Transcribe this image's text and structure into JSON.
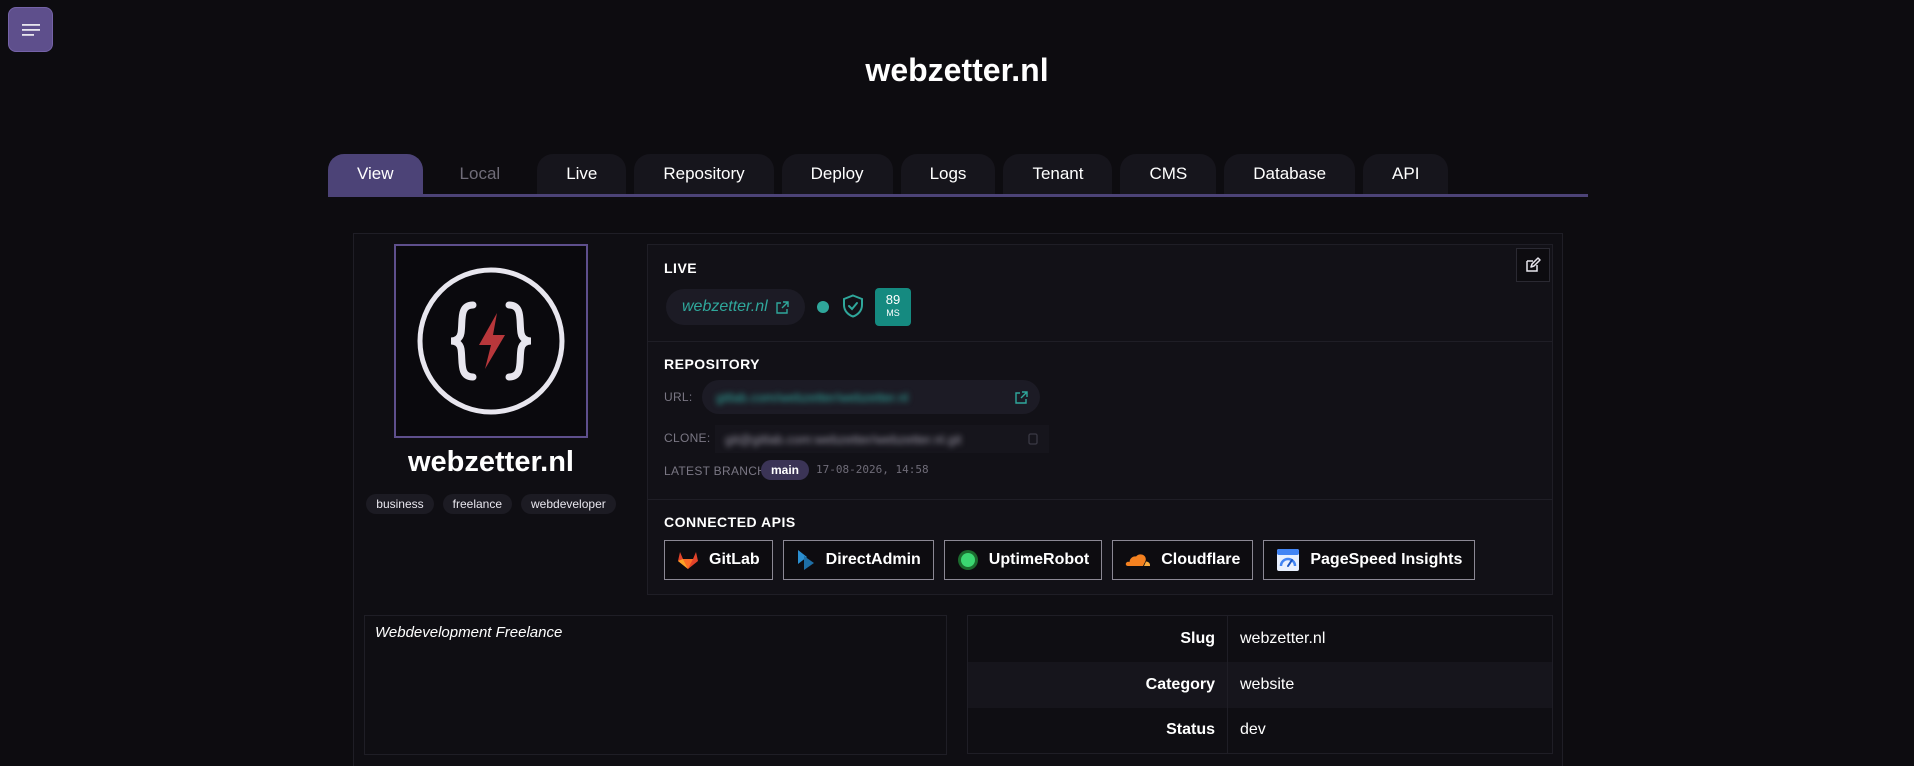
{
  "page": {
    "title": "webzetter.nl"
  },
  "menu": {
    "icon": "hamburger-icon",
    "accent": "#5e4f8c"
  },
  "tabs": [
    {
      "label": "View",
      "state": "active"
    },
    {
      "label": "Local",
      "state": "disabled"
    },
    {
      "label": "Live",
      "state": "normal"
    },
    {
      "label": "Repository",
      "state": "normal"
    },
    {
      "label": "Deploy",
      "state": "normal"
    },
    {
      "label": "Logs",
      "state": "normal"
    },
    {
      "label": "Tenant",
      "state": "normal"
    },
    {
      "label": "CMS",
      "state": "normal"
    },
    {
      "label": "Database",
      "state": "normal"
    },
    {
      "label": "API",
      "state": "normal"
    }
  ],
  "project": {
    "name": "webzetter.nl",
    "logo_icon": "curly-braces-lightning-logo",
    "tags": [
      "business",
      "freelance",
      "webdeveloper"
    ]
  },
  "live": {
    "label": "LIVE",
    "link_text": "webzetter.nl",
    "status_color": "#2fa79b",
    "response_value": "89",
    "response_unit": "MS"
  },
  "repository": {
    "label": "REPOSITORY",
    "url_label": "URL:",
    "url_value": "gitlab.com/webzetter/webzetter.nl",
    "clone_label": "CLONE:",
    "clone_value": "git@gitlab.com:webzetter/webzetter.nl.git",
    "branch_label": "LATEST BRANCH:",
    "branch": "main",
    "branch_date": "17-08-2026, 14:58"
  },
  "connected_apis": {
    "label": "CONNECTED APIS",
    "items": [
      {
        "label": "GitLab",
        "icon": "gitlab-icon"
      },
      {
        "label": "DirectAdmin",
        "icon": "directadmin-icon"
      },
      {
        "label": "UptimeRobot",
        "icon": "uptimerobot-icon"
      },
      {
        "label": "Cloudflare",
        "icon": "cloudflare-icon"
      },
      {
        "label": "PageSpeed Insights",
        "icon": "pagespeed-icon"
      }
    ]
  },
  "description": "Webdevelopment Freelance",
  "meta": [
    {
      "key": "Slug",
      "value": "webzetter.nl"
    },
    {
      "key": "Category",
      "value": "website"
    },
    {
      "key": "Status",
      "value": "dev"
    }
  ]
}
